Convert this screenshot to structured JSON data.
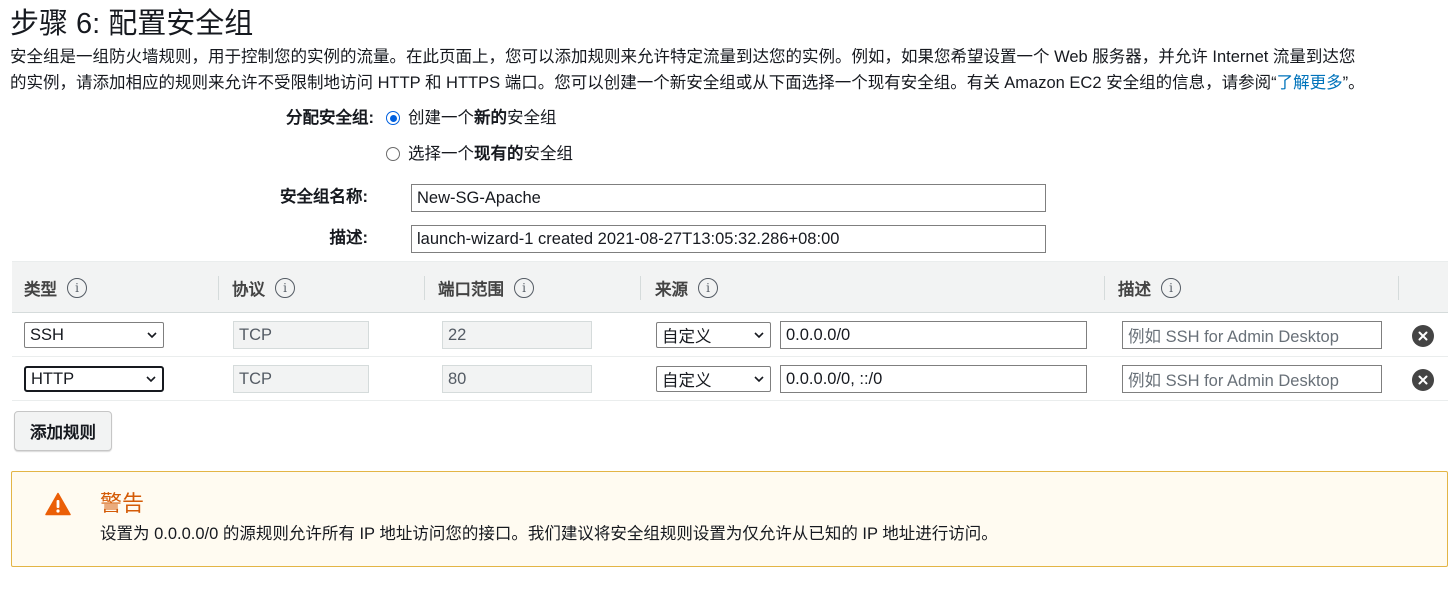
{
  "page": {
    "title": "步骤 6: 配置安全组",
    "description_line1": "安全组是一组防火墙规则，用于控制您的实例的流量。在此页面上，您可以添加规则来允许特定流量到达您的实例。例如，如果您希望设置一个 Web 服务器，并允许 Internet 流量到达您",
    "description_line2_prefix": "的实例，请添加相应的规则来允许不受限制地访问 HTTP 和 HTTPS 端口。您可以创建一个新安全组或从下面选择一个现有安全组。有关 Amazon EC2 安全组的信息，请参阅“",
    "learn_more": "了解更多",
    "description_line2_suffix": "”。"
  },
  "assign": {
    "label": "分配安全组:",
    "option_new_pre": "创建一个",
    "option_new_bold": "新的",
    "option_new_post": "安全组",
    "option_existing_pre": "选择一个",
    "option_existing_bold": "现有的",
    "option_existing_post": "安全组",
    "selected": "new"
  },
  "form": {
    "name_label": "安全组名称:",
    "name_value": "New-SG-Apache",
    "desc_label": "描述:",
    "desc_value": "launch-wizard-1 created 2021-08-27T13:05:32.286+08:00"
  },
  "table": {
    "headers": {
      "type": "类型",
      "protocol": "协议",
      "port_range": "端口范围",
      "source": "来源",
      "description": "描述"
    },
    "info_glyph": "i",
    "rows": [
      {
        "type": "SSH",
        "protocol": "TCP",
        "port": "22",
        "source_type": "自定义",
        "source_cidr": "0.0.0.0/0",
        "description_placeholder": "例如 SSH for Admin Desktop"
      },
      {
        "type": "HTTP",
        "protocol": "TCP",
        "port": "80",
        "source_type": "自定义",
        "source_cidr": "0.0.0.0/0, ::/0",
        "description_placeholder": "例如 SSH for Admin Desktop"
      }
    ]
  },
  "actions": {
    "add_rule": "添加规则"
  },
  "warning": {
    "title": "警告",
    "text": "设置为 0.0.0.0/0 的源规则允许所有 IP 地址访问您的接口。我们建议将安全组规则设置为仅允许从已知的 IP 地址进行访问。"
  },
  "colors": {
    "link": "#0073bb",
    "warning_title": "#d45b07",
    "warning_icon": "#eb5f07",
    "warning_border": "#e3b546",
    "warning_bg": "#fffbf1",
    "radio_checked": "#0060df"
  }
}
